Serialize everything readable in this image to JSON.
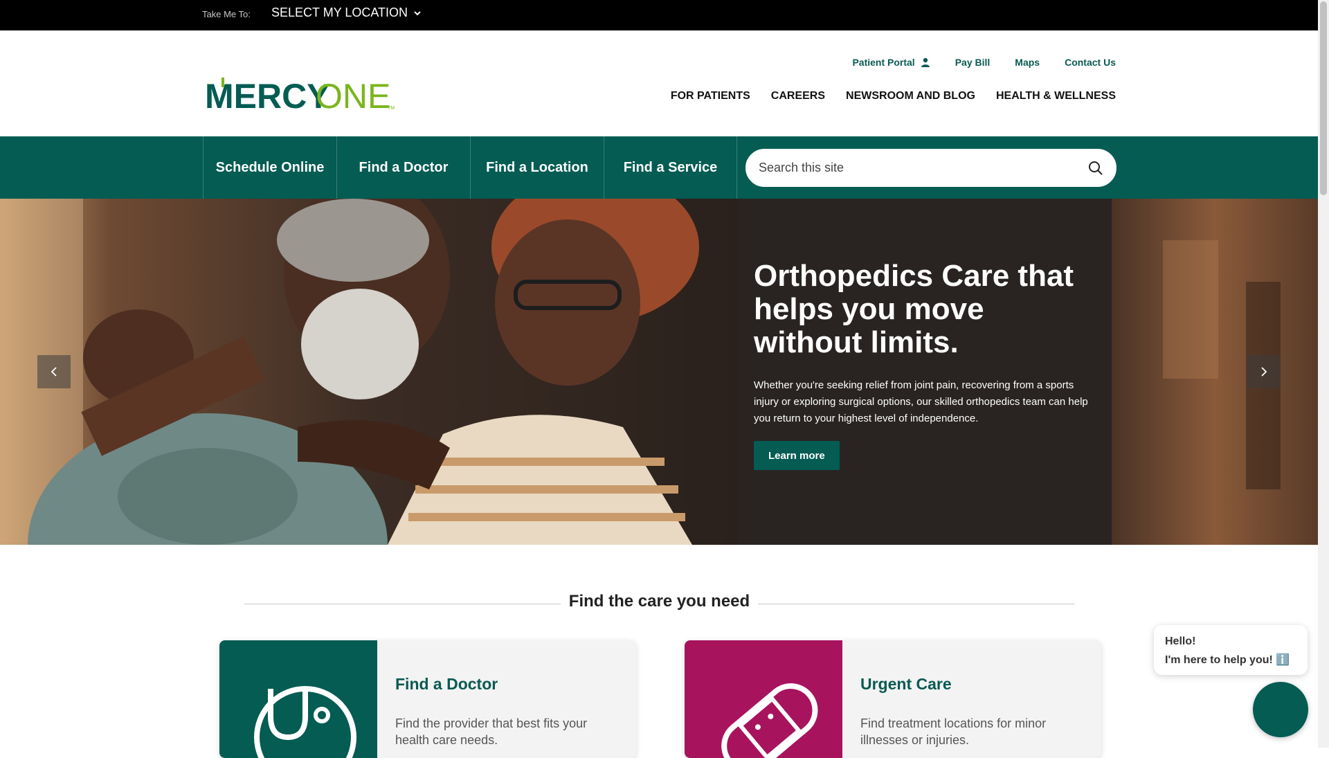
{
  "topbar": {
    "take_me_to_label": "Take Me To:",
    "location_select_value": "SELECT MY LOCATION"
  },
  "header": {
    "logo_text_mercy": "MERCY",
    "logo_text_one": "ONE",
    "logo_tm": "TM",
    "utility_nav": {
      "patient_portal": "Patient Portal",
      "pay_bill": "Pay Bill",
      "maps": "Maps",
      "contact_us": "Contact Us"
    },
    "main_nav": {
      "for_patients": "FOR PATIENTS",
      "careers": "CAREERS",
      "newsroom": "NEWSROOM AND BLOG",
      "health_wellness": "HEALTH & WELLNESS"
    }
  },
  "actionbar": {
    "schedule_online": "Schedule Online",
    "find_doctor": "Find a Doctor",
    "find_location": "Find a Location",
    "find_service": "Find a Service",
    "search_placeholder": "Search this site"
  },
  "hero": {
    "title": "Orthopedics Care that helps you move without limits.",
    "body": "Whether you're seeking relief from joint pain, recovering from a sports injury or exploring surgical options, our skilled orthopedics team can help you return to your highest level of independence.",
    "button_label": "Learn more"
  },
  "care_section": {
    "heading": "Find the care you need",
    "cards": [
      {
        "title": "Find a Doctor",
        "description": "Find the provider that best fits your health care needs.",
        "icon": "stethoscope-icon",
        "color": "#045c53"
      },
      {
        "title": "Urgent Care",
        "description": "Find treatment locations for minor illnesses or injuries.",
        "icon": "bandage-icon",
        "color": "#a8135e"
      }
    ]
  },
  "chat": {
    "greeting": "Hello!",
    "message": "I'm here to help you! ℹ️"
  },
  "colors": {
    "brand_green": "#045c53",
    "brand_lime": "#7ab51d",
    "brand_magenta": "#a8135e"
  }
}
